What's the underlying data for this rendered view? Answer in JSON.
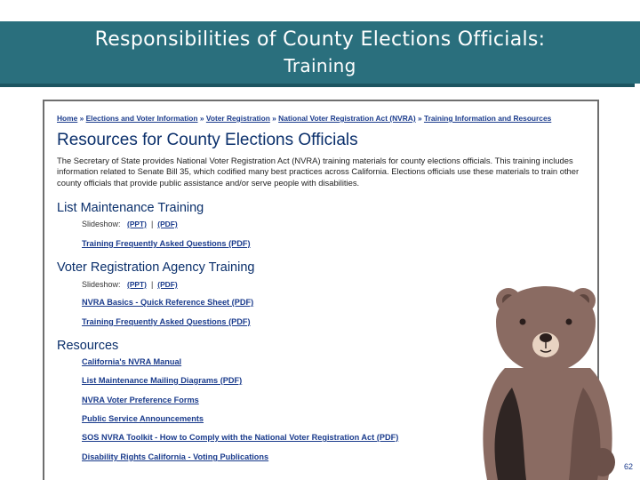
{
  "slide": {
    "title_line1": "Responsibilities of County Elections Officials:",
    "title_line2": "Training",
    "page_number": "62"
  },
  "webpage": {
    "breadcrumbs": [
      "Home",
      "Elections and Voter Information",
      "Voter Registration",
      "National Voter Registration Act (NVRA)",
      "Training Information and Resources"
    ],
    "heading": "Resources for County Elections Officials",
    "intro": "The Secretary of State provides National Voter Registration Act (NVRA) training materials for county elections officials. This training includes information related to Senate Bill 35, which codified many best practices across California. Elections officials use these materials to train other county officials that provide public assistance and/or serve people with disabilities.",
    "sections": [
      {
        "title": "List Maintenance Training",
        "slideshow_label": "Slideshow:",
        "ppt": "(PPT)",
        "divider": "|",
        "pdf": "(PDF)",
        "links": [
          "Training Frequently Asked Questions (PDF)"
        ]
      },
      {
        "title": "Voter Registration Agency Training",
        "slideshow_label": "Slideshow:",
        "ppt": "(PPT)",
        "divider": "|",
        "pdf": "(PDF)",
        "links": [
          "NVRA Basics - Quick Reference Sheet (PDF)",
          "Training Frequently Asked Questions (PDF)"
        ]
      },
      {
        "title": "Resources",
        "links": [
          "California's NVRA Manual",
          "List Maintenance Mailing Diagrams (PDF)",
          "NVRA Voter Preference Forms",
          "Public Service Announcements",
          "SOS NVRA Toolkit - How to Comply with the National Voter Registration Act (PDF)",
          "Disability Rights California - Voting Publications"
        ]
      }
    ]
  },
  "colors": {
    "title_bar": "#2a6f7d",
    "heading_blue": "#0a2f6b",
    "link_blue": "#1a3b8c",
    "bear_brown": "#8a6b62"
  },
  "icons": {
    "mascot": "bear-illustration"
  }
}
